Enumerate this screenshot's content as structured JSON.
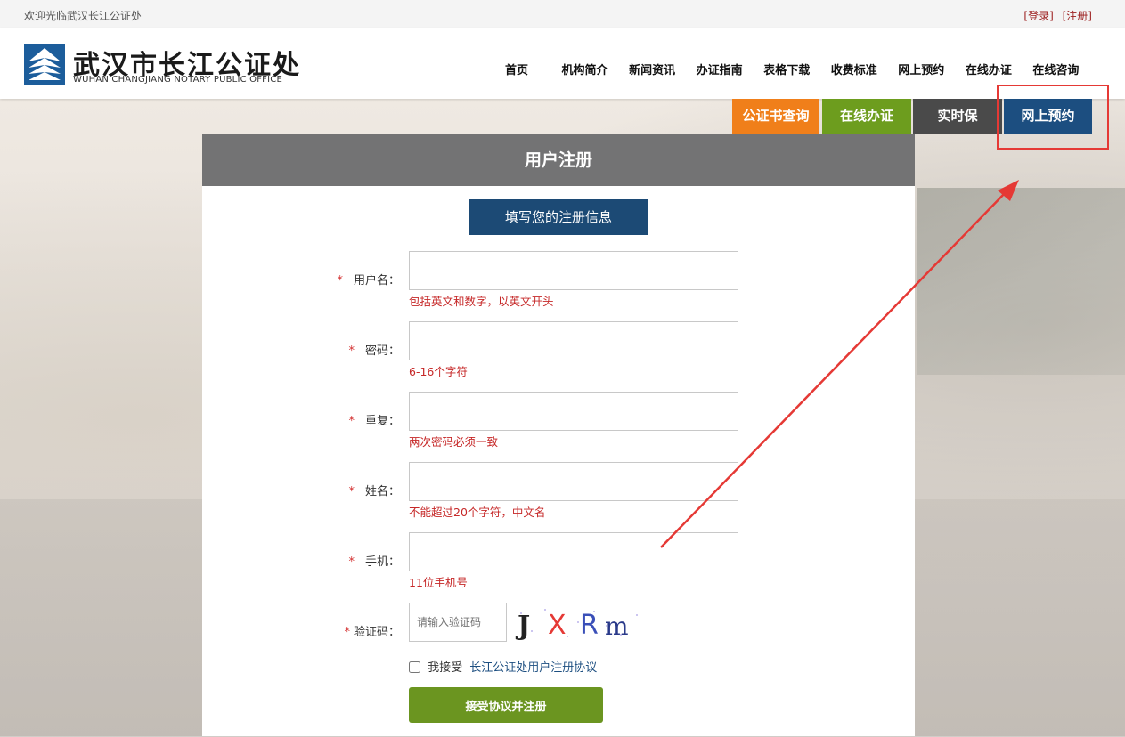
{
  "topbar": {
    "welcome": "欢迎光临武汉长江公证处",
    "login": "[登录]",
    "register": "[注册]"
  },
  "header": {
    "logo_title": "武汉市长江公证处",
    "logo_subtitle": "WUHAN CHANGJIANG NOTARY PUBLIC OFFICE",
    "nav": [
      "首页",
      "机构简介",
      "新闻资讯",
      "办证指南",
      "表格下载",
      "收费标准",
      "网上预约",
      "在线办证",
      "在线咨询"
    ]
  },
  "quick_links": {
    "q1": "公证书查询",
    "q2": "在线办证",
    "q3": "实时保",
    "q4": "网上预约"
  },
  "panel": {
    "title": "用户注册",
    "subtitle_button": "填写您的注册信息",
    "fields": [
      {
        "label": "用户名：",
        "hint": "包括英文和数字，以英文开头",
        "value": ""
      },
      {
        "label": "密码：",
        "hint": "6-16个字符",
        "value": ""
      },
      {
        "label": "重复：",
        "hint": "两次密码必须一致",
        "value": ""
      },
      {
        "label": "姓名：",
        "hint": "不能超过20个字符，中文名",
        "value": ""
      },
      {
        "label": "手机：",
        "hint": "11位手机号",
        "value": ""
      }
    ],
    "captcha": {
      "label": "验证码：",
      "placeholder": "请输入验证码",
      "text": "JXRm"
    },
    "agree_text": "我接受",
    "agree_link": "长江公证处用户注册协议",
    "submit": "接受协议并注册",
    "required_mark": "*"
  },
  "colors": {
    "orange": "#f07f1a",
    "green": "#6d9d1e",
    "dark": "#4a4a4a",
    "blue": "#1c4e80",
    "annotation": "#e53935"
  }
}
